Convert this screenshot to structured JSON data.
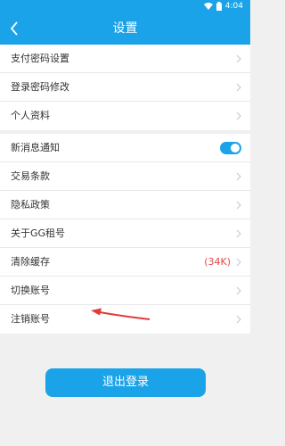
{
  "status_bar": {
    "time": "4:04"
  },
  "header": {
    "title": "设置",
    "back_icon": "chevron-left-icon"
  },
  "settings_group_1": [
    {
      "label": "支付密码设置"
    },
    {
      "label": "登录密码修改"
    },
    {
      "label": "个人资料"
    }
  ],
  "settings_group_2": {
    "notification": {
      "label": "新消息通知",
      "enabled": true
    },
    "items": [
      {
        "label": "交易条款"
      },
      {
        "label": "隐私政策"
      },
      {
        "label": "关于GG租号"
      }
    ],
    "clear_cache": {
      "label": "清除缓存",
      "value": "(34K)"
    },
    "switch_account": {
      "label": "切换账号"
    },
    "cancel_account": {
      "label": "注销账号"
    }
  },
  "logout_button": {
    "label": "退出登录"
  },
  "colors": {
    "primary": "#1aa3e8",
    "cache_value": "#e24646",
    "arrow": "#e53935"
  }
}
